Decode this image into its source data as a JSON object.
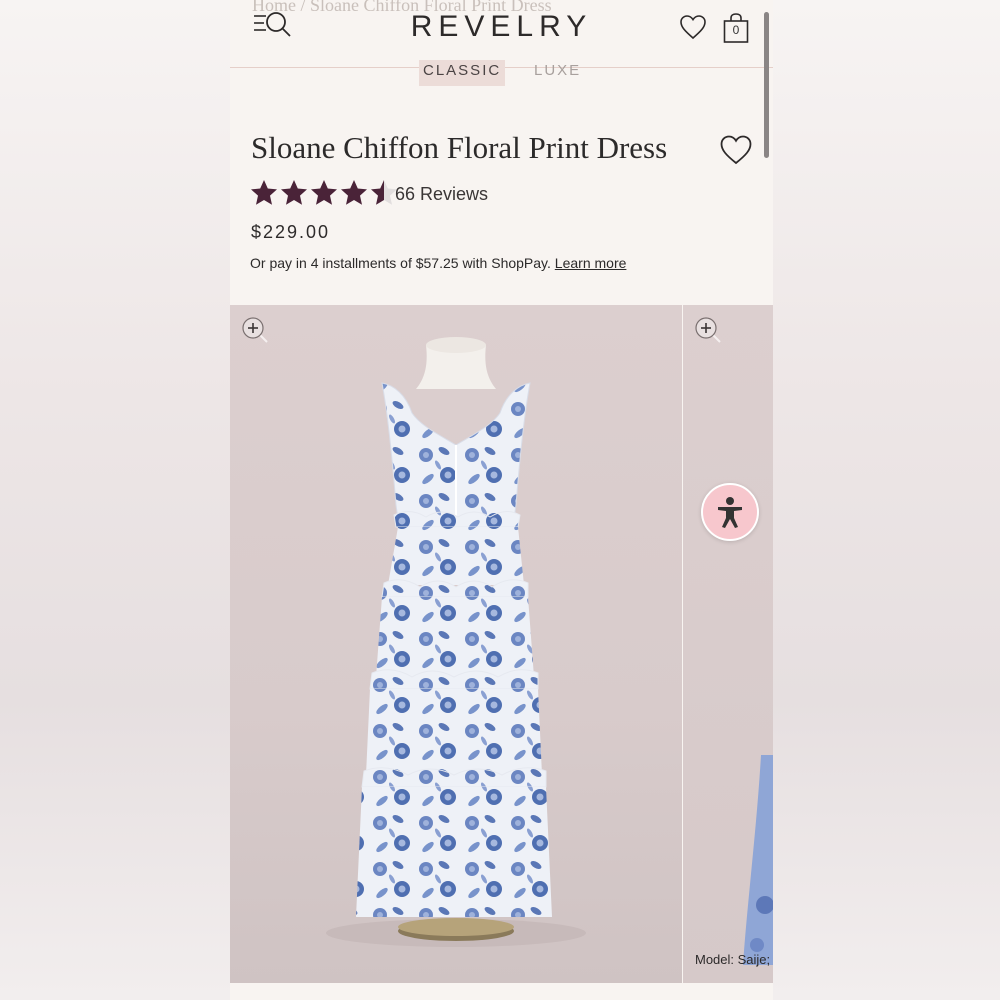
{
  "header": {
    "breadcrumb": "Home / Sloane Chiffon Floral Print Dress",
    "logo": "REVELRY",
    "bag_count": "0",
    "tabs": [
      {
        "label": "CLASSIC",
        "active": true
      },
      {
        "label": "LUXE",
        "active": false
      }
    ]
  },
  "product": {
    "title": "Sloane Chiffon Floral Print Dress",
    "rating": 4.5,
    "rating_max": 5,
    "reviews_label": "66 Reviews",
    "price": "$229.00",
    "installments_text": "Or pay in 4 installments of $57.25 with ShopPay.",
    "learn_more": "Learn more"
  },
  "gallery": {
    "model_caption": "Model: Saije;"
  },
  "icons": {
    "menu": "menu-icon",
    "search": "search-icon",
    "wishlist": "heart-icon",
    "bag": "shopping-bag-icon",
    "zoom": "zoom-in-icon",
    "accessibility": "accessibility-icon",
    "star": "star-icon"
  },
  "colors": {
    "star_filled": "#4a2338",
    "star_empty": "#e2dede",
    "accent_tab": "#ecdcd8",
    "accessibility_bg": "#f7c7cd",
    "divider": "#e5cfc9"
  }
}
